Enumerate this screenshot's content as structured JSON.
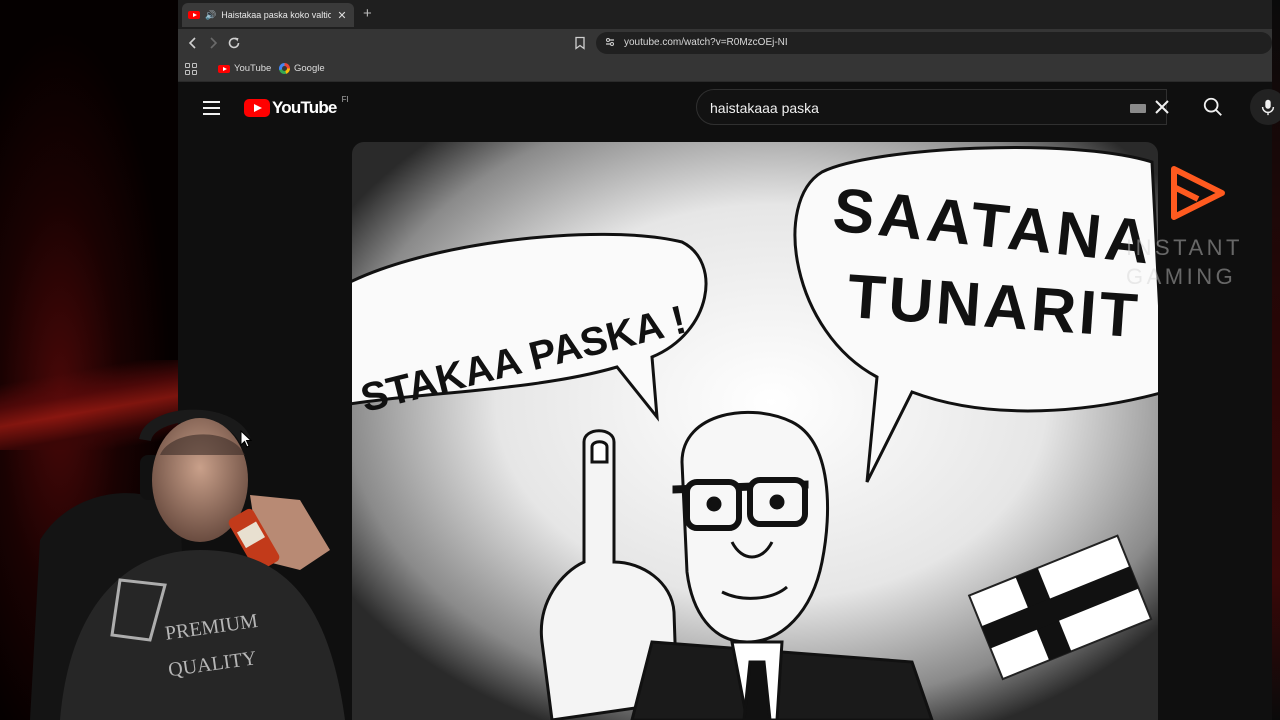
{
  "browser": {
    "tab": {
      "title": "Haistakaa paska koko valtiov",
      "close": "✕"
    },
    "new_tab": "+",
    "url": "youtube.com/watch?v=R0MzcOEj-NI",
    "bookmarks": [
      {
        "label": "YouTube",
        "icon": "youtube-icon"
      },
      {
        "label": "Google",
        "icon": "google-icon"
      }
    ]
  },
  "youtube": {
    "logo_text": "YouTube",
    "region": "FI",
    "search_query": "haistakaaa paska"
  },
  "video": {
    "bubble_left": "STAKAA PASKA !",
    "bubble_right_line1": "SAATANA",
    "bubble_right_line2": "TUNARIT"
  },
  "sponsor": {
    "line1": "INSTANT",
    "line2": "GAMING"
  },
  "webcam": {
    "shirt_line1": "PREMIUM",
    "shirt_line2": "QUALITY"
  },
  "colors": {
    "yt_red": "#ff0000",
    "sponsor_orange": "#ff5a1f",
    "bg": "#0f0f0f"
  }
}
